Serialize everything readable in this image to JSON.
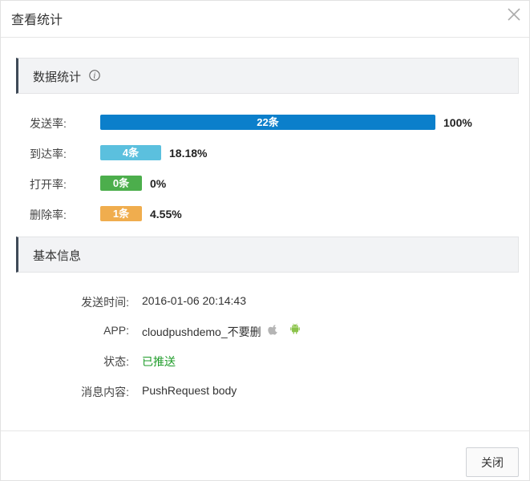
{
  "dialog": {
    "title": "查看统计",
    "close_button": "关闭"
  },
  "stats_section": {
    "title": "数据统计",
    "rows": [
      {
        "label": "发送率:",
        "bar_text": "22条",
        "percent_text": "100%",
        "fraction": 1.0,
        "color": "#0b7fcb"
      },
      {
        "label": "到达率:",
        "bar_text": "4条",
        "percent_text": "18.18%",
        "fraction": 0.1818,
        "color": "#5bc0de"
      },
      {
        "label": "打开率:",
        "bar_text": "0条",
        "percent_text": "0%",
        "fraction": 0.0,
        "color": "#4cae4c"
      },
      {
        "label": "删除率:",
        "bar_text": "1条",
        "percent_text": "4.55%",
        "fraction": 0.0455,
        "color": "#f0ad4e"
      }
    ]
  },
  "info_section": {
    "title": "基本信息",
    "send_time_label": "发送时间:",
    "send_time_value": "2016-01-06 20:14:43",
    "app_label": "APP:",
    "app_value": "cloudpushdemo_不要删",
    "status_label": "状态:",
    "status_value": "已推送",
    "content_label": "消息内容:",
    "content_value": "PushRequest body"
  },
  "colors": {
    "status_green": "#1f9c2a",
    "android_green": "#8bc34a",
    "apple_gray": "#b5b5b5"
  }
}
